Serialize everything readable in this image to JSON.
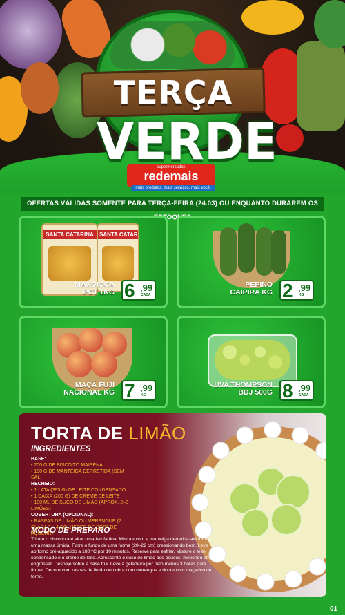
{
  "header": {
    "title_top": "TERÇA",
    "title_main": "VERDE",
    "brand_small": "supermercados",
    "brand_name": "redemais",
    "tagline": "mais produtos, mais serviços, mais você."
  },
  "offer_banner": "OFERTAS VÁLIDAS SOMENTE PARA TERÇA-FEIRA (24.03) OU ENQUANTO DURAREM OS ESTOQUES",
  "products": [
    {
      "name_l1": "MANDIOCA",
      "name_l2": "PCT 1KG",
      "price_int": "6",
      "price_dec": ",99",
      "unit": "CADA",
      "package_text": "SANTA CATARINA"
    },
    {
      "name_l1": "PEPINO",
      "name_l2": "CAIPIRA KG",
      "price_int": "2",
      "price_dec": ",99",
      "unit": "KG"
    },
    {
      "name_l1": "MAÇÃ FUJI",
      "name_l2": "NACIONAL KG",
      "price_int": "7",
      "price_dec": ",99",
      "unit": "KG"
    },
    {
      "name_l1": "UVA THOMPSON",
      "name_l2": "BDJ 500G",
      "price_int": "8",
      "price_dec": ",99",
      "unit": "CADA"
    }
  ],
  "recipe": {
    "title_a": "TORTA DE",
    "title_b": "LIMÃO",
    "ingredients_heading": "INGREDIENTES",
    "base_label": "BASE:",
    "base_items": [
      "• 200 G DE BISCOITO MAISENA",
      "• 100 G DE MANTEIGA DERRETIDA (SEM SAL)"
    ],
    "filling_label": "RECHEIO:",
    "filling_items": [
      "• 1 LATA (395 G) DE LEITE CONDENSADO",
      "• 1 CAIXA (200 G) DE CREME DE LEITE",
      "• 100 ML DE SUCO DE LIMÃO (APROX. 2–3 LIMÕES)"
    ],
    "topping_label": "COBERTURA (OPCIONAL):",
    "topping_items": [
      "• RASPAS DE LIMÃO OU MERENGUE (2 CLARAS + 4 COLHERES DE SOPA DE AÇÚCAR)"
    ],
    "prep_heading": "MODO DE PREPARO",
    "prep_text": "Triture o biscoito até virar uma farofa fina. Misture com a manteiga derretida até formar uma massa úmida. Forre o fundo de uma forma (20–22 cm) pressionando bem. Leve ao forno pré-aquecido a 180 °C por 10 minutos. Reserve para esfriar. Misture o leite condensado e o creme de leite. Acrescente o suco de limão aos poucos, mexendo até engrossar. Despeje sobre a base fria. Leve à geladeira por pelo menos 3 horas para firmar. Decore com raspas de limão ou cubra com merengue e doure com maçarico ou forno."
  },
  "page_number": "01",
  "colors": {
    "green": "#22a62c",
    "dark_green": "#0e6a18",
    "red": "#e1261c",
    "wine": "#6e0f20",
    "accent": "#f5b82e"
  }
}
